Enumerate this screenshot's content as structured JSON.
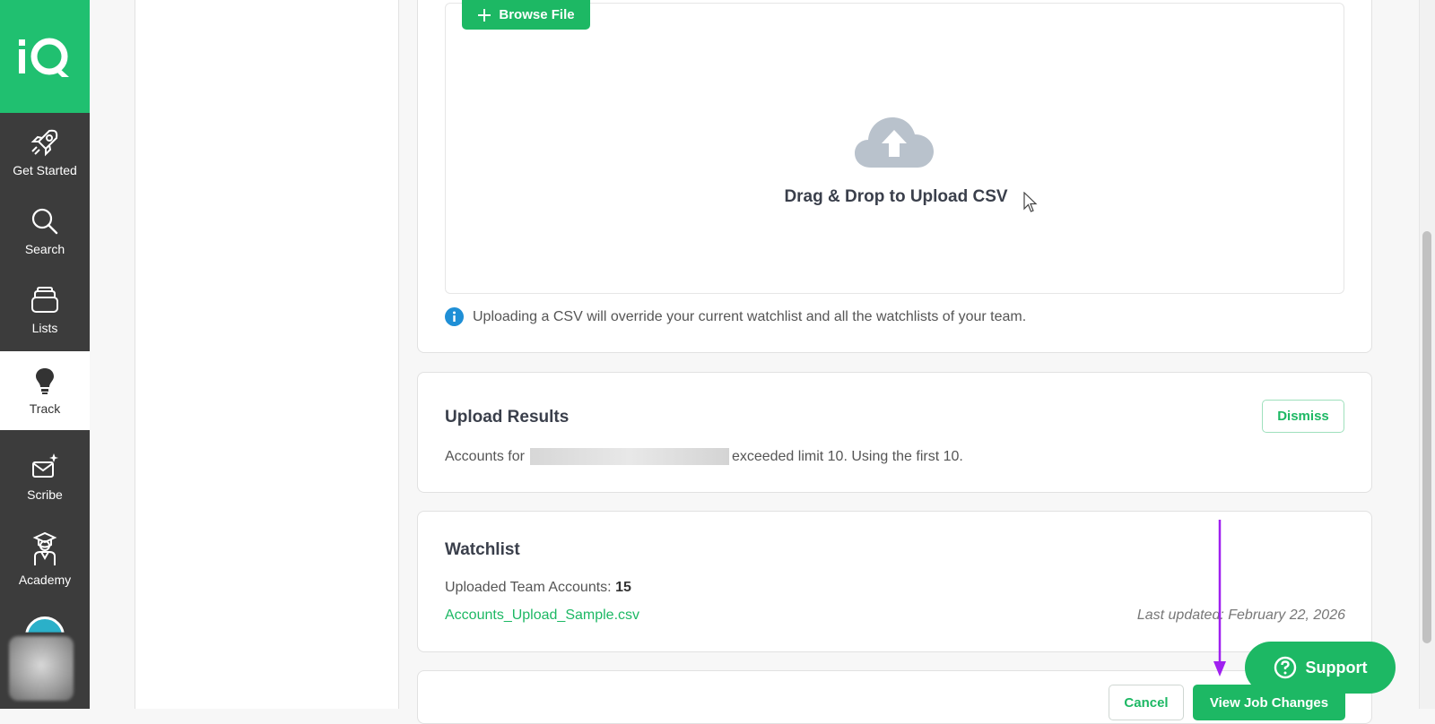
{
  "sidebar": {
    "logo": "iQ",
    "items": [
      {
        "label": "Get Started",
        "icon": "rocket-icon"
      },
      {
        "label": "Search",
        "icon": "magnifier-icon"
      },
      {
        "label": "Lists",
        "icon": "stack-icon"
      },
      {
        "label": "Track",
        "icon": "lightbulb-icon",
        "active": true
      },
      {
        "label": "Scribe",
        "icon": "sparkle-mail-icon"
      },
      {
        "label": "Academy",
        "icon": "graduate-icon"
      }
    ]
  },
  "upload": {
    "browse_label": "Browse File",
    "drop_label": "Drag & Drop to Upload CSV",
    "info_text": "Uploading a CSV will override your current watchlist and all the watchlists of your team."
  },
  "results": {
    "title": "Upload Results",
    "dismiss_label": "Dismiss",
    "msg_prefix": "Accounts for",
    "msg_suffix": "exceeded limit 10. Using the first 10."
  },
  "watchlist": {
    "title": "Watchlist",
    "count_label": "Uploaded Team Accounts:",
    "count_value": "15",
    "file_name": "Accounts_Upload_Sample.csv",
    "updated_label": "Last updated: February 22, 2026"
  },
  "footer": {
    "cancel_label": "Cancel",
    "view_label": "View Job Changes"
  },
  "support": {
    "label": "Support"
  },
  "colors": {
    "brand_green": "#1db864",
    "sidebar_bg": "#3c3c3c",
    "annotation_arrow": "#a020f0"
  }
}
